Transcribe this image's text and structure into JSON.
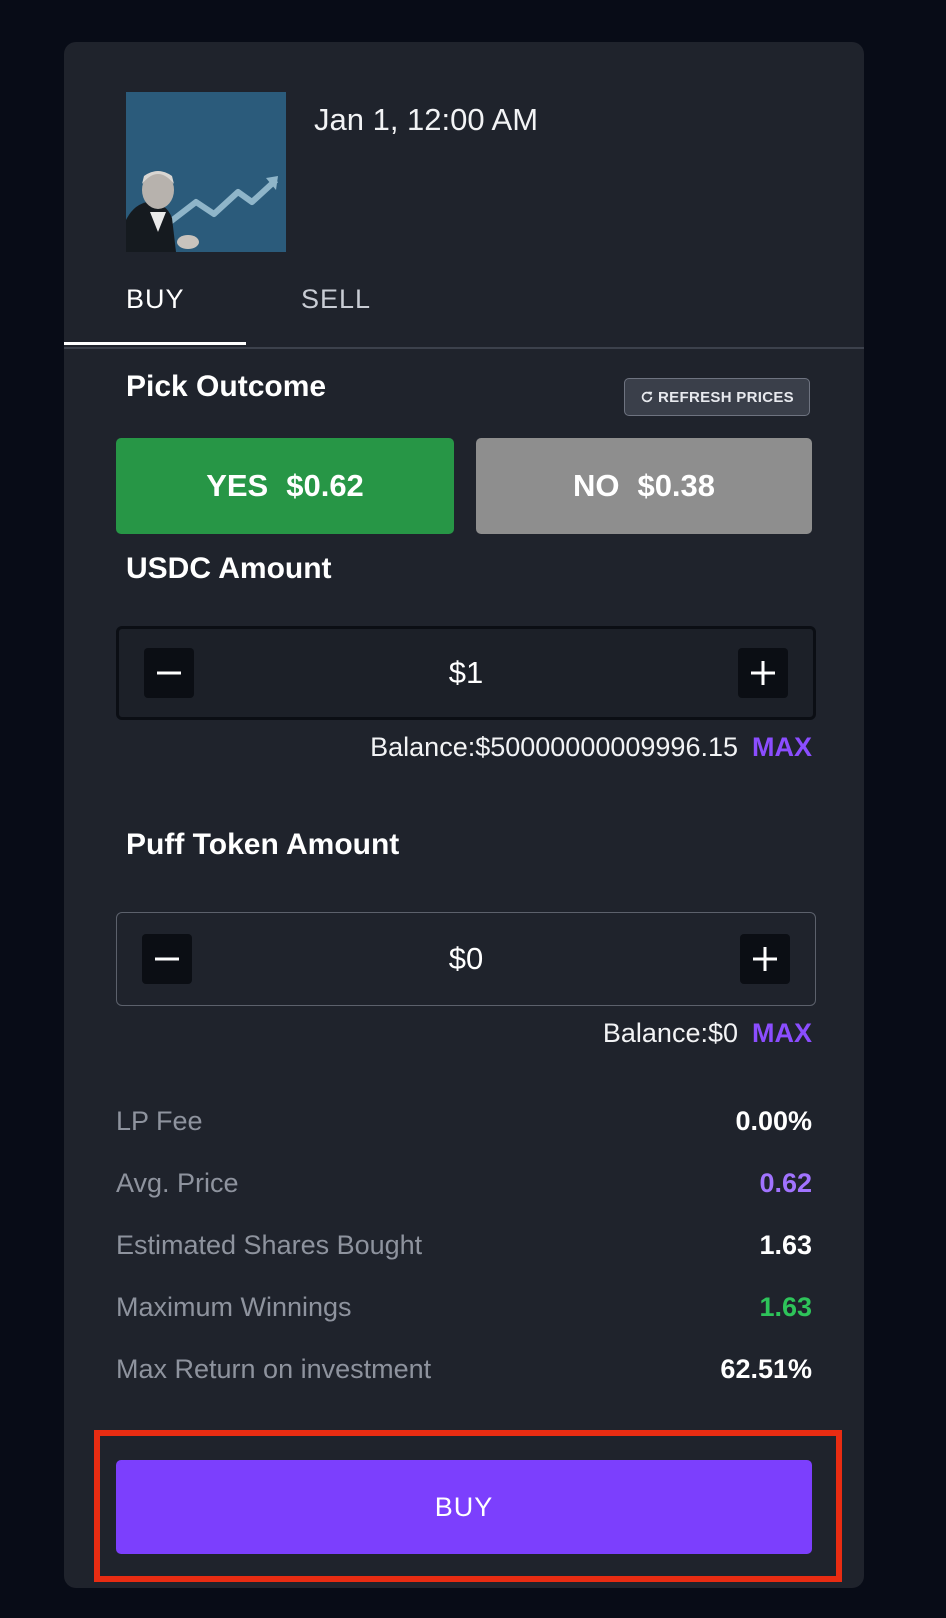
{
  "market": {
    "date": "Jan 1, 12:00 AM"
  },
  "tabs": {
    "buy": "BUY",
    "sell": "SELL",
    "active": "BUY"
  },
  "pick_outcome": {
    "label": "Pick Outcome",
    "refresh_label": "REFRESH PRICES",
    "yes": {
      "label": "YES",
      "price": "$0.62",
      "color": "#279646",
      "selected": true
    },
    "no": {
      "label": "NO",
      "price": "$0.38",
      "color": "#8e8e8e",
      "selected": false
    }
  },
  "usdc": {
    "label": "USDC Amount",
    "value": "$1",
    "balance": "Balance:$50000000009996.15",
    "max_label": "MAX"
  },
  "puff": {
    "label": "Puff Token Amount",
    "value": "$0",
    "balance": "Balance:$0",
    "max_label": "MAX"
  },
  "stats": [
    {
      "label": "LP Fee",
      "value": "0.00%",
      "color": "#ffffff"
    },
    {
      "label": "Avg. Price",
      "value": "0.62",
      "color": "#a173ff"
    },
    {
      "label": "Estimated Shares Bought",
      "value": "1.63",
      "color": "#ffffff"
    },
    {
      "label": "Maximum Winnings",
      "value": "1.63",
      "color": "#2ec35a"
    },
    {
      "label": "Max Return on investment",
      "value": "62.51%",
      "color": "#ffffff"
    }
  ],
  "action": {
    "buy_label": "BUY",
    "color": "#7c3ffd",
    "highlight_color": "#e82c12"
  },
  "icons": [
    "market-image",
    "refresh-icon",
    "minus-icon",
    "plus-icon"
  ]
}
